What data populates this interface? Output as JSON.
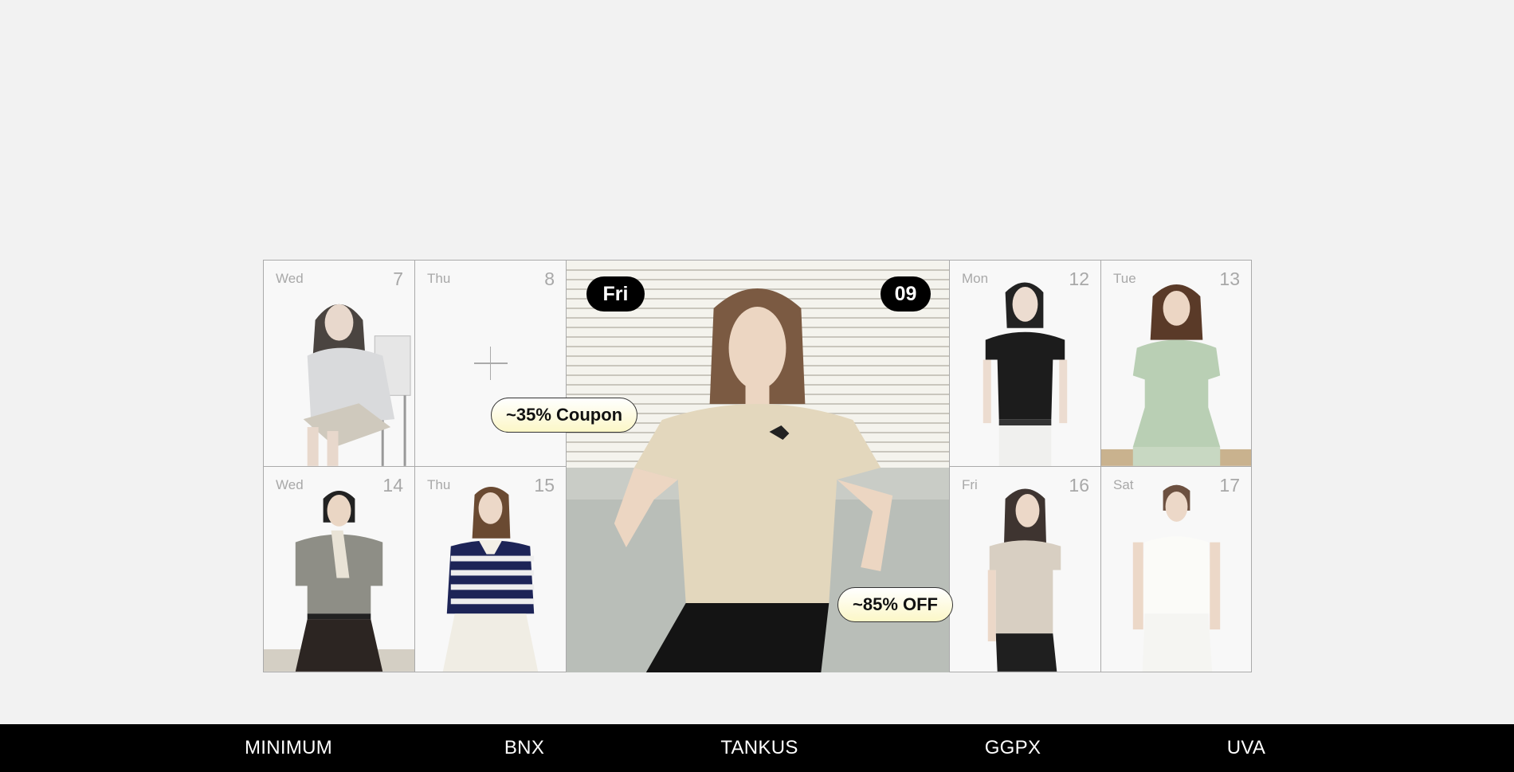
{
  "calendar": {
    "cells": [
      {
        "day": "Wed",
        "num": "7"
      },
      {
        "day": "Thu",
        "num": "8"
      },
      {
        "day": "Mon",
        "num": "12"
      },
      {
        "day": "Tue",
        "num": "13"
      },
      {
        "day": "Wed",
        "num": "14"
      },
      {
        "day": "Thu",
        "num": "15"
      },
      {
        "day": "Fri",
        "num": "16"
      },
      {
        "day": "Sat",
        "num": "17"
      }
    ],
    "featured": {
      "day": "Fri",
      "num": "09",
      "coupon_badge": "~35% Coupon",
      "off_badge": "~85% OFF"
    }
  },
  "brands": [
    "MINIMUM",
    "BNX",
    "TANKUS",
    "GGPX",
    "UVA"
  ],
  "colors": {
    "background": "#f2f2f2",
    "brandbar": "#000000",
    "badge_gradient_end": "#fcf7c7",
    "muted_text": "#a8a8a8"
  }
}
